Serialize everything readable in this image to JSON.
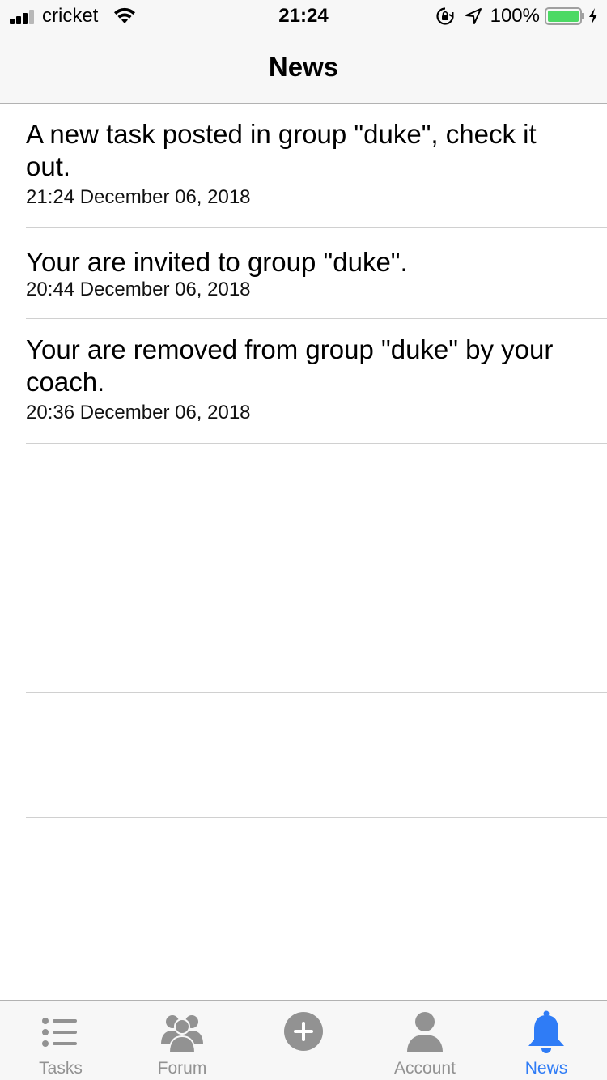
{
  "status_bar": {
    "carrier": "cricket",
    "time": "21:24",
    "battery_percent": "100%",
    "battery_level": 1.0,
    "icons": [
      "signal-bars-icon",
      "wifi-icon",
      "rotation-lock-icon",
      "location-arrow-icon",
      "battery-icon",
      "charging-bolt-icon"
    ]
  },
  "nav": {
    "title": "News"
  },
  "news": [
    {
      "message": "A new task posted in group \"duke\", check it out.",
      "time": "21:24 December 06, 2018"
    },
    {
      "message": "Your are invited to group \"duke\".",
      "time": "20:44 December 06, 2018"
    },
    {
      "message": "Your are removed from group \"duke\" by your coach.",
      "time": "20:36 December 06, 2018"
    }
  ],
  "tabs": [
    {
      "label": "Tasks",
      "icon": "list-icon",
      "active": false
    },
    {
      "label": "Forum",
      "icon": "people-icon",
      "active": false
    },
    {
      "label": "",
      "icon": "plus-circle-icon",
      "active": false
    },
    {
      "label": "Account",
      "icon": "person-icon",
      "active": false
    },
    {
      "label": "News",
      "icon": "bell-icon",
      "active": true
    }
  ],
  "colors": {
    "accent": "#2f7cf6",
    "inactive_tab": "#929292",
    "battery": "#4cd964",
    "bar_background": "#f7f7f7"
  }
}
